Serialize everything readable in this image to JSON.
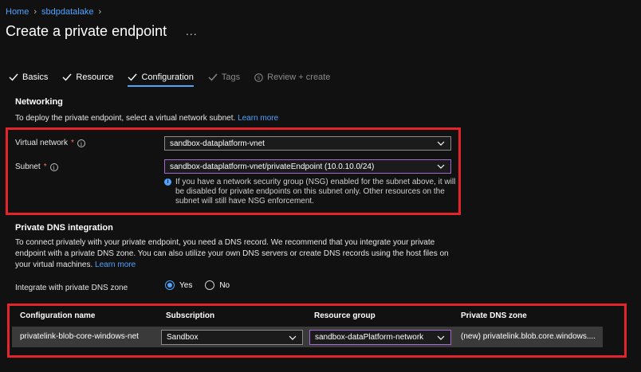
{
  "breadcrumb": {
    "home": "Home",
    "current": "sbdpdatalake"
  },
  "page": {
    "title": "Create a private endpoint",
    "more": "..."
  },
  "tabs": [
    {
      "label": "Basics",
      "state": "completed"
    },
    {
      "label": "Resource",
      "state": "completed"
    },
    {
      "label": "Configuration",
      "state": "active"
    },
    {
      "label": "Tags",
      "state": "disabled"
    },
    {
      "label": "Review + create",
      "state": "disabled"
    }
  ],
  "networking": {
    "heading": "Networking",
    "intro": "To deploy the private endpoint, select a virtual network subnet.",
    "learn_more": "Learn more",
    "vnet_label": "Virtual network",
    "vnet_value": "sandbox-dataplatform-vnet",
    "subnet_label": "Subnet",
    "subnet_value": "sandbox-dataplatform-vnet/privateEndpoint (10.0.10.0/24)",
    "required_mark": "*",
    "note": "If you have a network security group (NSG) enabled for the subnet above, it will be disabled for private endpoints on this subnet only. Other resources on the subnet will still have NSG enforcement."
  },
  "dns": {
    "heading": "Private DNS integration",
    "intro": "To connect privately with your private endpoint, you need a DNS record. We recommend that you integrate your private endpoint with a private DNS zone. You can also utilize your own DNS servers or create DNS records using the host files on your virtual machines.",
    "learn_more": "Learn more",
    "integrate_label": "Integrate with private DNS zone",
    "yes": "Yes",
    "no": "No",
    "selected": "Yes",
    "table": {
      "headers": [
        "Configuration name",
        "Subscription",
        "Resource group",
        "Private DNS zone"
      ],
      "row": {
        "config_name": "privatelink-blob-core-windows-net",
        "subscription": "Sandbox",
        "resource_group": "sandbox-dataPlatform-network",
        "dns_zone": "(new) privatelink.blob.core.windows...."
      }
    }
  },
  "colors": {
    "accent": "#4da3ff",
    "highlight_box": "#e3242b",
    "background": "#111111"
  }
}
